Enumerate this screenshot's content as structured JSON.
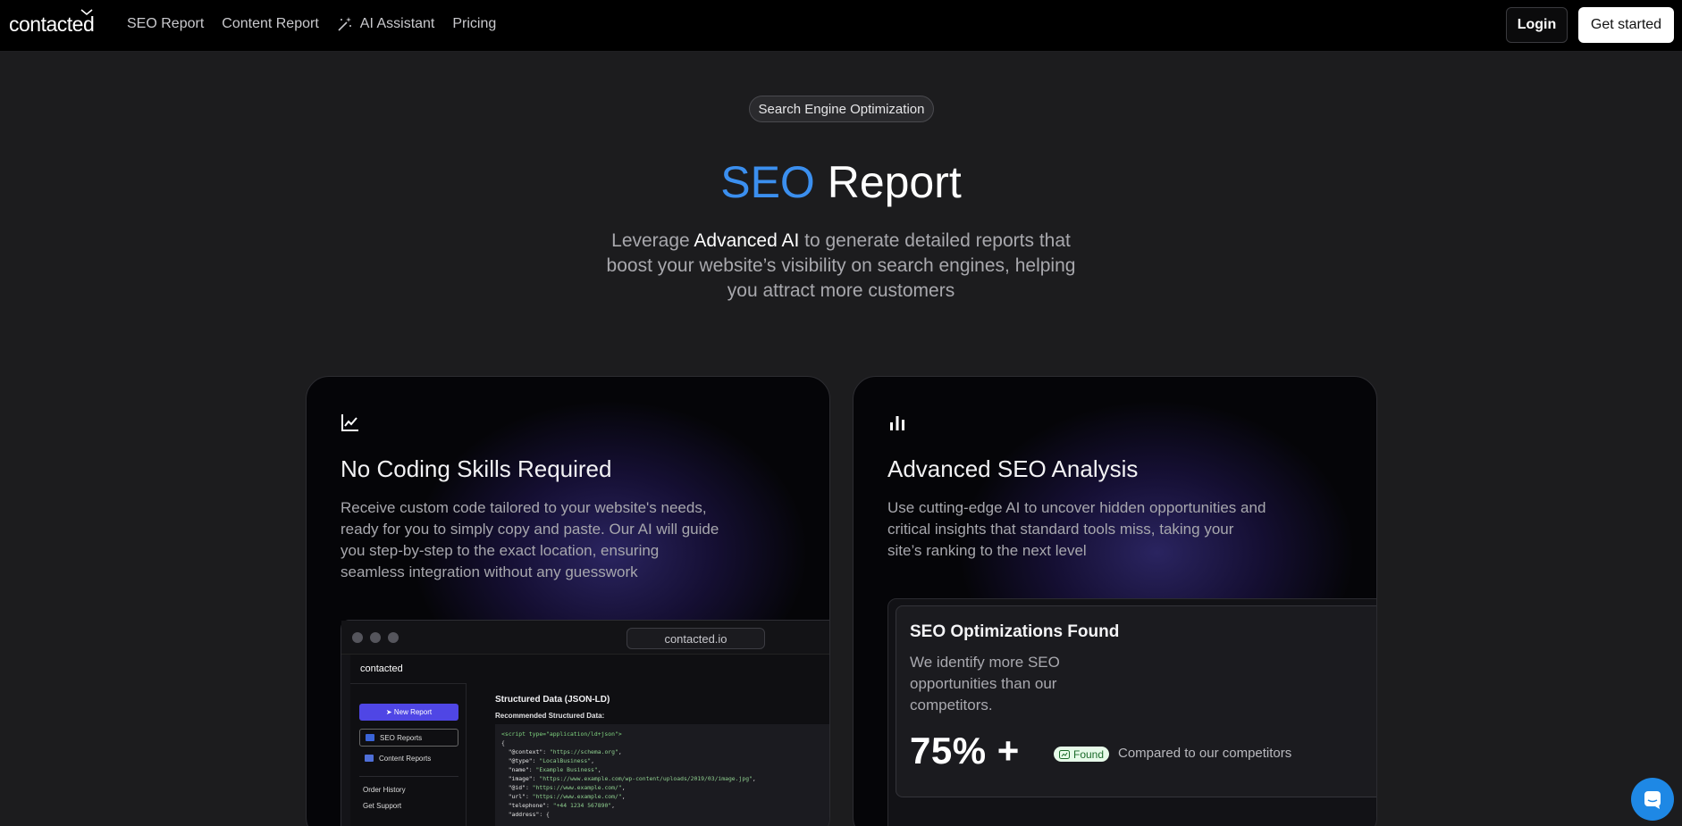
{
  "nav": {
    "logo": "contacted",
    "links": [
      "SEO Report",
      "Content Report",
      "AI Assistant",
      "Pricing"
    ],
    "login": "Login",
    "get_started": "Get started"
  },
  "hero": {
    "pill": "Search Engine Optimization",
    "title_accent": "SEO",
    "title_rest": " Report",
    "sub_pre": "Leverage ",
    "sub_highlight": "Advanced AI",
    "sub_post": " to generate detailed reports that boost your website’s visibility on search engines, helping you attract more customers"
  },
  "cards": [
    {
      "icon": "line-chart-icon",
      "title": "No Coding Skills Required",
      "text": "Receive custom code tailored to your website's needs, ready for you to simply copy and paste. Our AI will guide you step-by-step to the exact location, ensuring seamless integration without any guesswork",
      "mockup": {
        "url": "contacted.io",
        "logo": "contacted",
        "new_report": "New Report",
        "items": [
          "SEO Reports",
          "Content Reports"
        ],
        "links": [
          "Order History",
          "Get Support"
        ],
        "heading": "Structured Data (JSON-LD)",
        "subheading": "Recommended Structured Data:"
      }
    },
    {
      "icon": "bar-chart-icon",
      "title": "Advanced SEO Analysis",
      "text": "Use cutting-edge AI to uncover hidden opportunities and critical insights that standard tools miss, taking your site’s ranking to the next level",
      "panel": {
        "title": "SEO Optimizations Found",
        "text": "We identify more SEO opportunities than our competitors.",
        "stat": "75% +",
        "badge": "Found",
        "compare": "Compared to our competitors"
      }
    }
  ],
  "colors": {
    "accent": "#3b8fef",
    "button_primary": "#4f46e5",
    "chat": "#1e88e5"
  }
}
